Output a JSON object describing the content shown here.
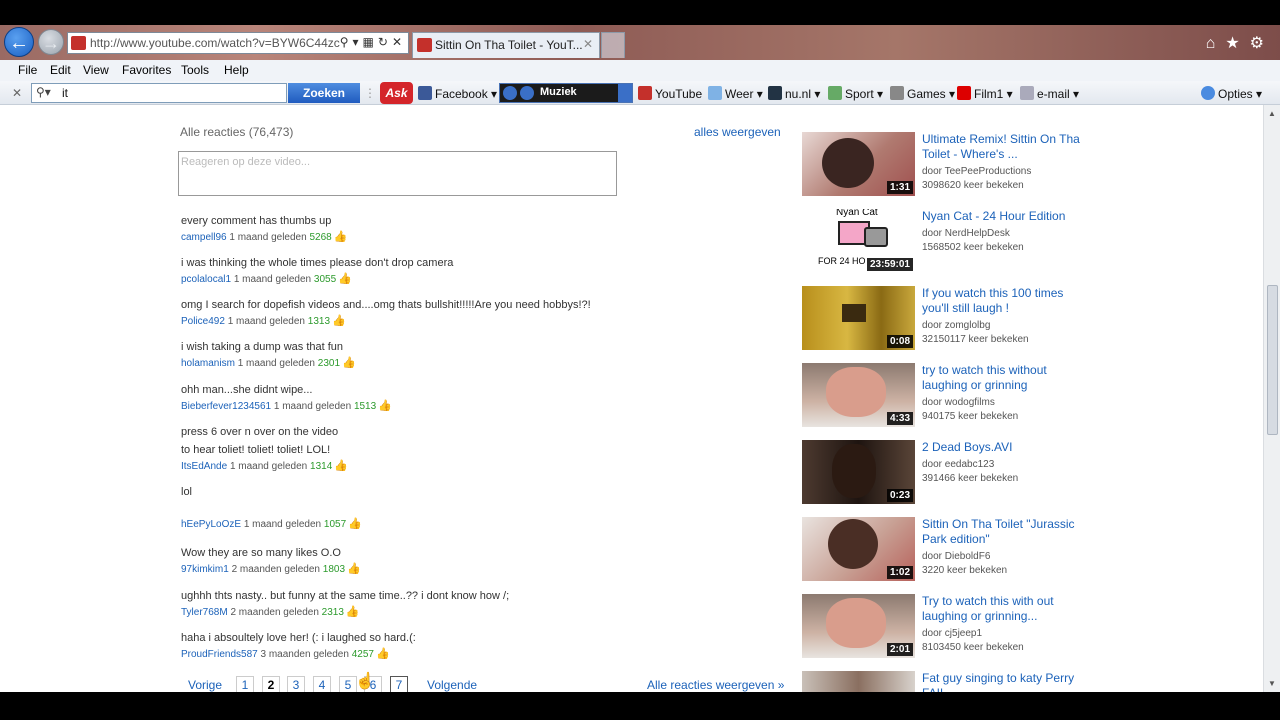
{
  "browser": {
    "address_url": "http://www.youtube.com/watch?v=BYW6C44zc",
    "tab_title": "Sittin On Tha Toilet - YouT...",
    "menu": [
      "File",
      "Edit",
      "View",
      "Favorites",
      "Tools",
      "Help"
    ],
    "search_value": "it",
    "search_button": "Zoeken",
    "ask_label": "Ask",
    "toolbar_items": {
      "facebook": "Facebook",
      "muziek": "Muziek",
      "youtube": "YouTube",
      "weer": "Weer",
      "nunl": "nu.nl",
      "sport": "Sport",
      "games": "Games",
      "film1": "Film1",
      "email": "e-mail",
      "opties": "Opties"
    }
  },
  "comments": {
    "header": "Alle reacties (76,473)",
    "show_all": "alles weergeven",
    "placeholder": "Reageren op deze video...",
    "items": [
      {
        "text": "every comment has thumbs up",
        "user": "campell96",
        "when": "1 maand geleden",
        "likes": "5268"
      },
      {
        "text": "i was thinking the whole times please don't drop camera",
        "user": "pcolalocal1",
        "when": "1 maand geleden",
        "likes": "3055"
      },
      {
        "text": "omg I search for dopefish videos and....omg thats bullshit!!!!!Are you need hobbys!?!",
        "user": "Police492",
        "when": "1 maand geleden",
        "likes": "1313"
      },
      {
        "text": "i wish taking a dump was that fun",
        "user": "holamanism",
        "when": "1 maand geleden",
        "likes": "2301"
      },
      {
        "text": "ohh man...she didnt wipe...",
        "user": "Bieberfever1234561",
        "when": "1 maand geleden",
        "likes": "1513"
      },
      {
        "text": "press 6 over n over on the video",
        "text2": "to hear toliet! toliet! toliet! LOL!",
        "user": "ItsEdAnde",
        "when": "1 maand geleden",
        "likes": "1314"
      },
      {
        "text": "lol",
        "user": "hEePyLoOzE",
        "when": "1 maand geleden",
        "likes": "1057"
      },
      {
        "text": "Wow they are so many likes O.O",
        "user": "97kimkim1",
        "when": "2 maanden geleden",
        "likes": "1803"
      },
      {
        "text": "ughhh thts nasty.. but funny at the same time..?? i dont know how /;",
        "user": "Tyler768M",
        "when": "2 maanden geleden",
        "likes": "2313"
      },
      {
        "text": "haha i absoultely love her! (: i laughed so hard.(:",
        "user": "ProudFriends587",
        "when": "3 maanden geleden",
        "likes": "4257"
      }
    ]
  },
  "pager": {
    "prev": "Vorige",
    "pages": [
      "1",
      "2",
      "3",
      "4",
      "5",
      "6",
      "7"
    ],
    "current": "2",
    "next": "Volgende",
    "all": "Alle reacties weergeven »"
  },
  "related": [
    {
      "title": "Ultimate Remix! Sittin On Tha Toilet - Where's ...",
      "by": "door TeePeeProductions",
      "views": "3098620 keer bekeken",
      "duration": "1:31"
    },
    {
      "title": "Nyan Cat - 24 Hour Edition",
      "by": "door NerdHelpDesk",
      "views": "1568502 keer bekeken",
      "duration": "23:59:01",
      "thumb_top": "Nyan Cat",
      "thumb_bottom": "FOR 24 HO"
    },
    {
      "title": "If you watch this 100 times you'll still laugh !",
      "by": "door zomglolbg",
      "views": "32150117 keer bekeken",
      "duration": "0:08"
    },
    {
      "title": "try to watch this without laughing or grinning",
      "by": "door wodogfilms",
      "views": "940175 keer bekeken",
      "duration": "4:33"
    },
    {
      "title": "2 Dead Boys.AVI",
      "by": "door eedabc123",
      "views": "391466 keer bekeken",
      "duration": "0:23"
    },
    {
      "title": "Sittin On Tha Toilet \"Jurassic Park edition\"",
      "by": "door DieboldF6",
      "views": "3220 keer bekeken",
      "duration": "1:02"
    },
    {
      "title": "Try to watch this with out laughing or grinning...",
      "by": "door cj5jeep1",
      "views": "8103450 keer bekeken",
      "duration": "2:01"
    },
    {
      "title": "Fat guy singing to katy Perry FAIL",
      "by": "",
      "views": "",
      "duration": ""
    }
  ]
}
